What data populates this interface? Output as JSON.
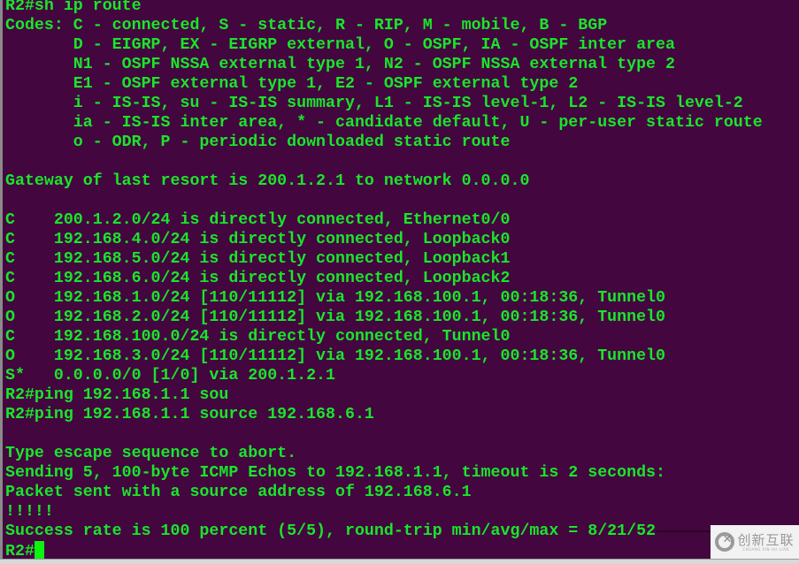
{
  "terminal": {
    "colors": {
      "background": "#43063f",
      "foreground": "#19e62a",
      "cursor": "#0df30d"
    },
    "lines": [
      "R2#sh ip route",
      "Codes: C - connected, S - static, R - RIP, M - mobile, B - BGP",
      "       D - EIGRP, EX - EIGRP external, O - OSPF, IA - OSPF inter area",
      "       N1 - OSPF NSSA external type 1, N2 - OSPF NSSA external type 2",
      "       E1 - OSPF external type 1, E2 - OSPF external type 2",
      "       i - IS-IS, su - IS-IS summary, L1 - IS-IS level-1, L2 - IS-IS level-2",
      "       ia - IS-IS inter area, * - candidate default, U - per-user static route",
      "       o - ODR, P - periodic downloaded static route",
      "",
      "Gateway of last resort is 200.1.2.1 to network 0.0.0.0",
      "",
      "C    200.1.2.0/24 is directly connected, Ethernet0/0",
      "C    192.168.4.0/24 is directly connected, Loopback0",
      "C    192.168.5.0/24 is directly connected, Loopback1",
      "C    192.168.6.0/24 is directly connected, Loopback2",
      "O    192.168.1.0/24 [110/11112] via 192.168.100.1, 00:18:36, Tunnel0",
      "O    192.168.2.0/24 [110/11112] via 192.168.100.1, 00:18:36, Tunnel0",
      "C    192.168.100.0/24 is directly connected, Tunnel0",
      "O    192.168.3.0/24 [110/11112] via 192.168.100.1, 00:18:36, Tunnel0",
      "S*   0.0.0.0/0 [1/0] via 200.1.2.1",
      "R2#ping 192.168.1.1 sou",
      "R2#ping 192.168.1.1 source 192.168.6.1",
      "",
      "Type escape sequence to abort.",
      "Sending 5, 100-byte ICMP Echos to 192.168.1.1, timeout is 2 seconds:",
      "Packet sent with a source address of 192.168.6.1",
      "!!!!!",
      "Success rate is 100 percent (5/5), round-trip min/avg/max = 8/21/52"
    ],
    "prompt": "R2#"
  },
  "watermark": {
    "icon": "chuangxin-logo-icon",
    "text_cn": "创新互联",
    "text_en": "CHUANG XIN HU LIAN"
  }
}
